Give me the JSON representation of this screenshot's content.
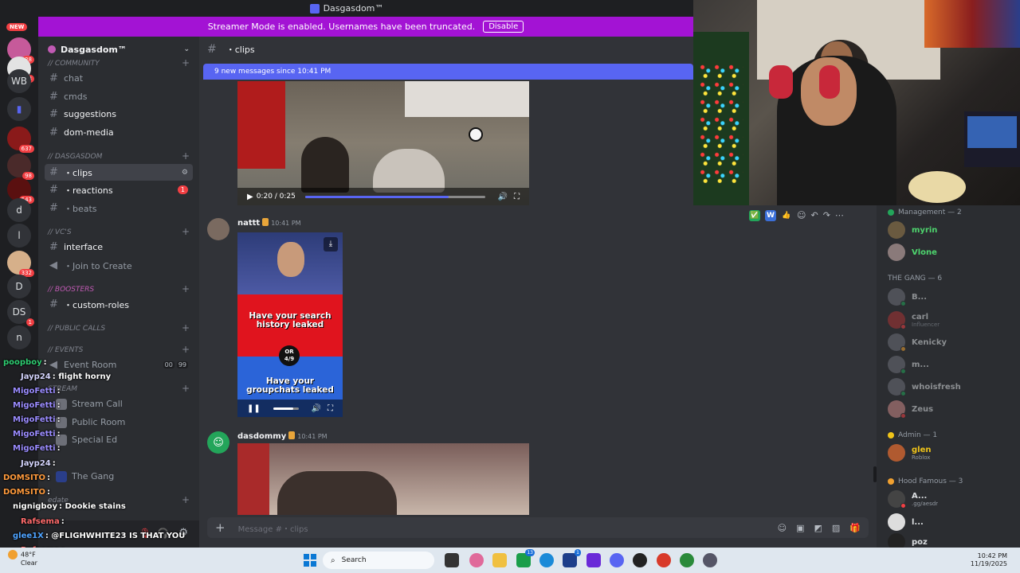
{
  "window": {
    "title": "Dasgasdom™"
  },
  "banner": {
    "text": "Streamer Mode is enabled. Usernames have been truncated.",
    "disable_label": "Disable"
  },
  "guilds": {
    "new_badge": "NEW",
    "items": [
      {
        "label": "",
        "badge": "28"
      },
      {
        "label": "",
        "badge": "3"
      },
      {
        "label": "WB",
        "badge": ""
      },
      {
        "label": "",
        "badge": ""
      },
      {
        "label": "",
        "badge": "637"
      },
      {
        "label": "",
        "badge": "98"
      },
      {
        "label": "",
        "badge": "543"
      },
      {
        "label": "d",
        "badge": ""
      },
      {
        "label": "l",
        "badge": ""
      },
      {
        "label": "",
        "badge": "332"
      },
      {
        "label": "D",
        "badge": ""
      },
      {
        "label": "DS",
        "badge": "1"
      },
      {
        "label": "n",
        "badge": ""
      }
    ]
  },
  "server": {
    "name": "Dasgasdom™"
  },
  "categories": {
    "community": "// Community",
    "dasgasdom": "// DASGASDOM",
    "vcs": "// Vc's",
    "boosters": "// Boosters",
    "public_calls": "// PUBLIC CALLS",
    "events": "// Events",
    "stream": "STREAM",
    "edate": "edate"
  },
  "channels": {
    "chat": "chat",
    "cmds": "cmds",
    "suggestions": "suggestions",
    "dom_media": "dom-media",
    "clips": "・clips",
    "reactions": "・reactions",
    "reactions_badge": "1",
    "beats": "・beats",
    "interface": "interface",
    "join_to_create": "・Join to Create",
    "custom_roles": "・custom-roles",
    "event_room": "Event Room",
    "event_room_count_a": "00",
    "event_room_count_b": "99",
    "stream_call": "Stream Call",
    "public_room": "Public Room",
    "special_ed": "Special Ed",
    "the_gang": "The Gang"
  },
  "stream_chat": [
    {
      "name": "poopboy",
      "text": ":",
      "color": "#2ecc71"
    },
    {
      "name": "Jayp24",
      "text": ": flight horny",
      "color": "#d6d6ff"
    },
    {
      "name": "MigoFetti",
      "text": ":",
      "color": "#9b8cff"
    },
    {
      "name": "MigoFetti",
      "text": ":",
      "color": "#9b8cff"
    },
    {
      "name": "MigoFetti",
      "text": ":",
      "color": "#9b8cff"
    },
    {
      "name": "MigoFetti",
      "text": ":",
      "color": "#9b8cff"
    },
    {
      "name": "MigoFetti",
      "text": ":",
      "color": "#9b8cff"
    },
    {
      "name": "Jayp24",
      "text": ":",
      "color": "#d6d6ff"
    },
    {
      "name": "DOMSITO",
      "text": ":",
      "color": "#ff9a3c"
    },
    {
      "name": "DOMSITO",
      "text": ":",
      "color": "#ff9a3c"
    },
    {
      "name": "nignigboy",
      "text": ": Dookie stains",
      "color": "#ffffff"
    },
    {
      "name": "Rafsema",
      "text": ":",
      "color": "#ff6b6b"
    },
    {
      "name": "glee1X",
      "text": ": @FLIGHWHITE23 IS THAT YOU",
      "color": "#4ea3ff"
    },
    {
      "name": "Rafsema",
      "text": ":",
      "color": "#ff6b6b"
    }
  ],
  "main": {
    "channel": "・clips",
    "new_messages": "9 new messages since 10:41 PM",
    "video1": {
      "time": "0:20 / 0:25",
      "progress": 0.8
    },
    "messages": [
      {
        "author": "nattt",
        "time": "10:41 PM"
      },
      {
        "author": "dasdommy",
        "time": "10:41 PM"
      }
    ],
    "wyr": {
      "top": "Have your search history leaked",
      "or_label": "OR",
      "count": "4/9",
      "bottom": "Have your groupchats leaked"
    },
    "reactions": [
      "✅",
      "W",
      "👍"
    ],
    "composer_placeholder": "Message #・clips"
  },
  "members": {
    "groups": [
      {
        "title": "Management — 2",
        "dot": "#23a55a"
      },
      {
        "title": "THE GANG — 6",
        "dot": ""
      },
      {
        "title": "Admin — 1",
        "dot": "#f0c419"
      },
      {
        "title": "Hood Famous — 3",
        "dot": "#f0a030"
      }
    ],
    "items": [
      {
        "name": "myrin",
        "sub": "",
        "color": "#4ed56e",
        "faded": false
      },
      {
        "name": "Vlone",
        "sub": "",
        "color": "#4ed56e",
        "faded": false
      },
      {
        "name": "B...",
        "sub": "",
        "color": "#dbdee1",
        "faded": true
      },
      {
        "name": "carl",
        "sub": "Influencer",
        "color": "#dbdee1",
        "faded": true
      },
      {
        "name": "Kenicky",
        "sub": "",
        "color": "#dbdee1",
        "faded": true
      },
      {
        "name": "m...",
        "sub": "",
        "color": "#dbdee1",
        "faded": true
      },
      {
        "name": "whoisfresh",
        "sub": "",
        "color": "#dbdee1",
        "faded": true
      },
      {
        "name": "Zeus",
        "sub": "",
        "color": "#dbdee1",
        "faded": true
      },
      {
        "name": "glen",
        "sub": "Roblox",
        "color": "#f0c419",
        "faded": false
      },
      {
        "name": "A...",
        "sub": ".gg/aesdr",
        "color": "#dbdee1",
        "faded": false
      },
      {
        "name": "l...",
        "sub": "",
        "color": "#dbdee1",
        "faded": false
      },
      {
        "name": "poz",
        "sub": "",
        "color": "#dbdee1",
        "faded": false
      }
    ]
  },
  "taskbar": {
    "weather_temp": "48°F",
    "weather_desc": "Clear",
    "search_label": "Search",
    "time": "10:42 PM",
    "date": "11/19/2025",
    "badges": {
      "app_13": "13",
      "app_1": "1"
    }
  }
}
